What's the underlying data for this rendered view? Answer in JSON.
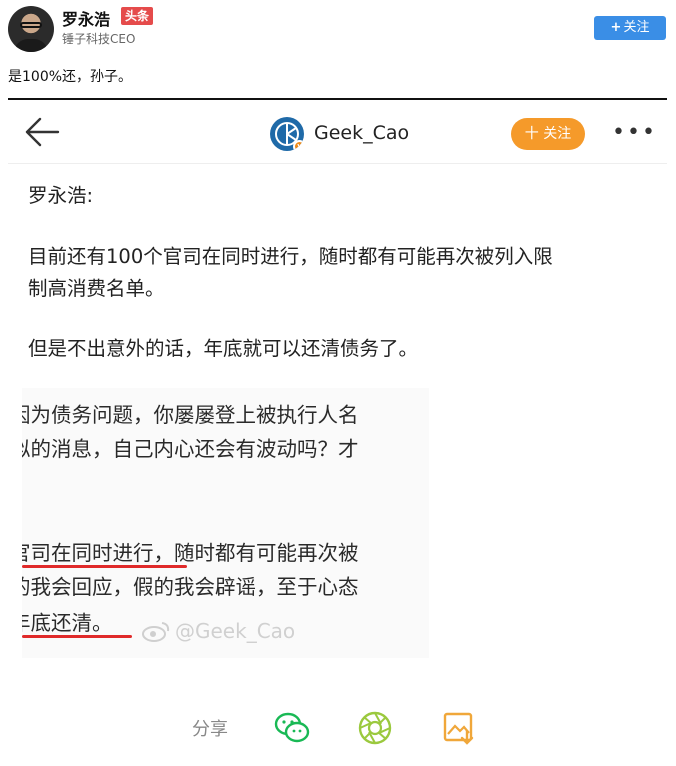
{
  "post": {
    "author_name": "罗永浩",
    "source_badge": "头条",
    "author_title": "锤子科技CEO",
    "follow_label": "关注",
    "text": "是100%还，孙子。"
  },
  "screenshot": {
    "username": "Geek_Cao",
    "follow_label": "十 关注",
    "more_label": "•••",
    "lines": [
      "罗永浩:",
      "目前还有100个官司在同时进行，随时都有可能再次被列入限",
      "制高消费名单。",
      "但是不出意外的话，年底就可以还清债务了。"
    ],
    "cropped_lines": [
      "因为债务问题，你屡屡登上被执行人名",
      "似的消息，自己内心还会有波动吗？才",
      "官司在同时进行，随时都有可能再次被",
      "的我会回应，假的我会辟谣，至于心态",
      "年底还清。"
    ],
    "watermark": "@Geek_Cao",
    "share_label": "分享"
  },
  "colors": {
    "follow_blue": "#3a8ee6",
    "follow_orange": "#f59a2a",
    "badge_red": "#e54b4b",
    "underline_red": "#e02a2a",
    "wechat_green": "#19b955",
    "moments_green": "#9bc93e",
    "save_orange": "#f0a73a"
  },
  "icons": [
    "back-arrow-icon",
    "verified-v-icon",
    "more-icon",
    "weibo-logo-icon",
    "wechat-icon",
    "moments-icon",
    "save-image-icon"
  ]
}
